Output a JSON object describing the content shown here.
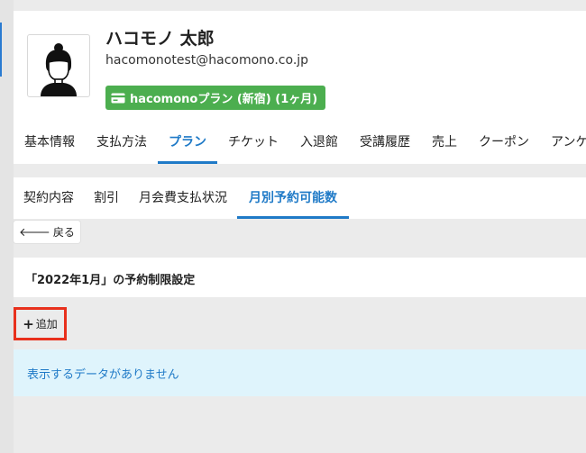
{
  "profile": {
    "name": "ハコモノ 太郎",
    "email": "hacomonotest@hacomono.co.jp",
    "plan_badge": "hacomonoプラン (新宿) (1ヶ月)",
    "plan_badge_icon": "credit-card-icon",
    "avatar_icon": "person-avatar-icon"
  },
  "main_tabs": [
    {
      "label": "基本情報"
    },
    {
      "label": "支払方法"
    },
    {
      "label": "プラン"
    },
    {
      "label": "チケット"
    },
    {
      "label": "入退館"
    },
    {
      "label": "受講履歴"
    },
    {
      "label": "売上"
    },
    {
      "label": "クーポン"
    },
    {
      "label": "アンケー"
    }
  ],
  "main_tabs_active": "プラン",
  "sub_tabs": [
    {
      "label": "契約内容"
    },
    {
      "label": "割引"
    },
    {
      "label": "月会費支払状況"
    },
    {
      "label": "月別予約可能数"
    }
  ],
  "sub_tabs_active": "月別予約可能数",
  "back_button": {
    "label": "戻る",
    "icon": "arrow-left-icon"
  },
  "section": {
    "title": "「2022年1月」の予約制限設定"
  },
  "add_button": {
    "label": "追加",
    "icon": "plus-icon"
  },
  "empty_message": "表示するデータがありません",
  "colors": {
    "accent": "#1f7ac7",
    "badge_green": "#4cae4f",
    "highlight_red": "#e8301c",
    "info_bg": "#dff4fc",
    "page_bg": "#ebebeb"
  }
}
